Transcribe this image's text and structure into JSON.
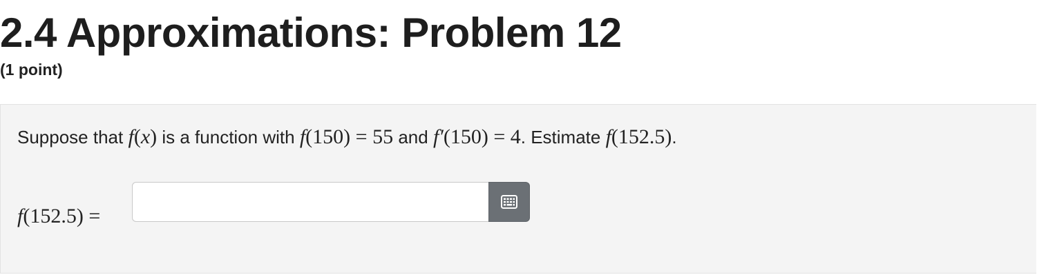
{
  "header": {
    "title": "2.4 Approximations: Problem 12",
    "points": "(1 point)"
  },
  "problem": {
    "intro": "Suppose that",
    "f": "f",
    "x": "x",
    "is_a_function_with": "is a function with",
    "f150": "(150)",
    "equals": "=",
    "value_55": "55",
    "and": "and",
    "fprime": "f′",
    "value_4": "4",
    "period_estimate": ". Estimate",
    "arg_152_5": "(152.5)",
    "end_period": "."
  },
  "answer": {
    "label_f": "f",
    "label_arg": "(152.5)",
    "label_equals": "=",
    "input_value": "",
    "keyboard_icon": "keyboard-icon"
  }
}
